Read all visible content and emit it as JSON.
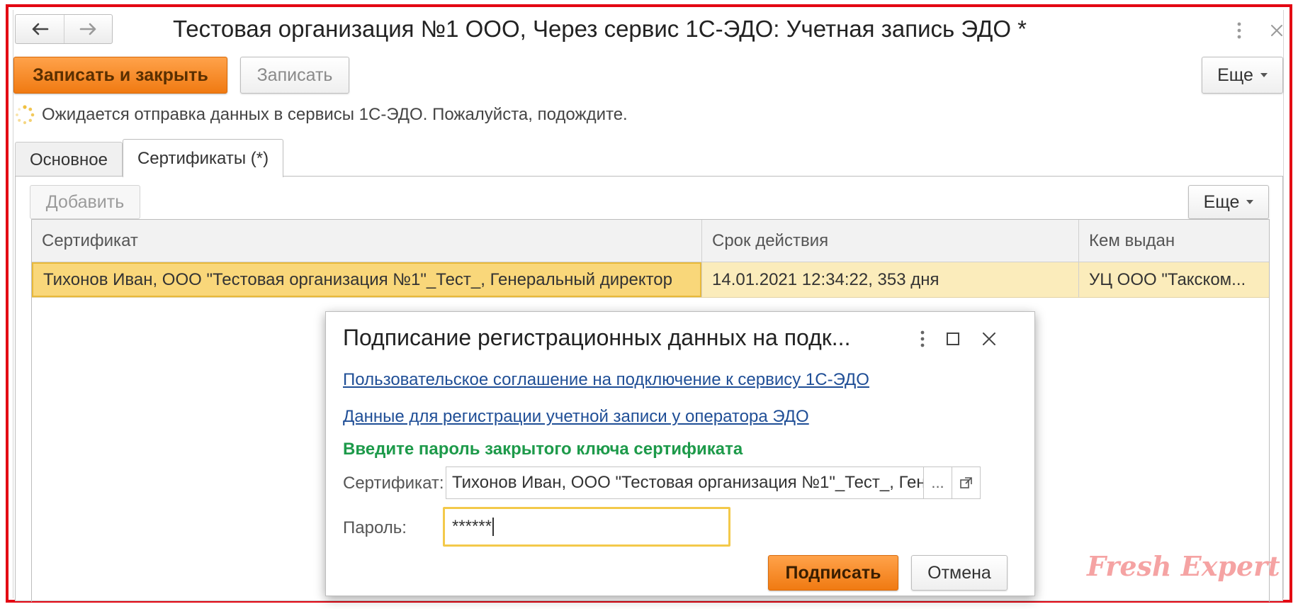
{
  "window": {
    "title": "Тестовая организация №1 ООО, Через сервис 1С-ЭДО: Учетная запись ЭДО *"
  },
  "toolbar": {
    "save_close_label": "Записать и закрыть",
    "save_label": "Записать",
    "more_label": "Еще"
  },
  "status": {
    "message": "Ожидается отправка данных в сервисы 1С-ЭДО. Пожалуйста, подождите."
  },
  "tabs": [
    {
      "label": "Основное",
      "active": false
    },
    {
      "label": "Сертификаты (*)",
      "active": true
    }
  ],
  "certificates_panel": {
    "add_label": "Добавить",
    "more_label": "Еще",
    "columns": [
      "Сертификат",
      "Срок действия",
      "Кем выдан"
    ],
    "rows": [
      [
        "Тихонов Иван, ООО \"Тестовая организация №1\"_Тест_, Генеральный директор",
        "14.01.2021 12:34:22, 353 дня",
        "УЦ ООО \"Такском..."
      ]
    ]
  },
  "dialog": {
    "title": "Подписание регистрационных данных на подк...",
    "link_agreement": "Пользовательское соглашение на подключение к сервису 1С-ЭДО",
    "link_registration": "Данные для регистрации учетной записи у оператора ЭДО",
    "prompt": "Введите пароль закрытого ключа сертификата",
    "certificate_label": "Сертификат:",
    "certificate_value": "Тихонов Иван, ООО \"Тестовая организация №1\"_Тест_, Ген",
    "certificate_choose": "...",
    "password_label": "Пароль:",
    "password_value": "******",
    "sign_label": "Подписать",
    "cancel_label": "Отмена"
  },
  "watermark": "Fresh Expert",
  "colors": {
    "frame": "#e30613",
    "primary": "#f07a12",
    "link": "#1f4e96",
    "prompt": "#1d9a4a",
    "selected_row": "#fbecbb"
  }
}
